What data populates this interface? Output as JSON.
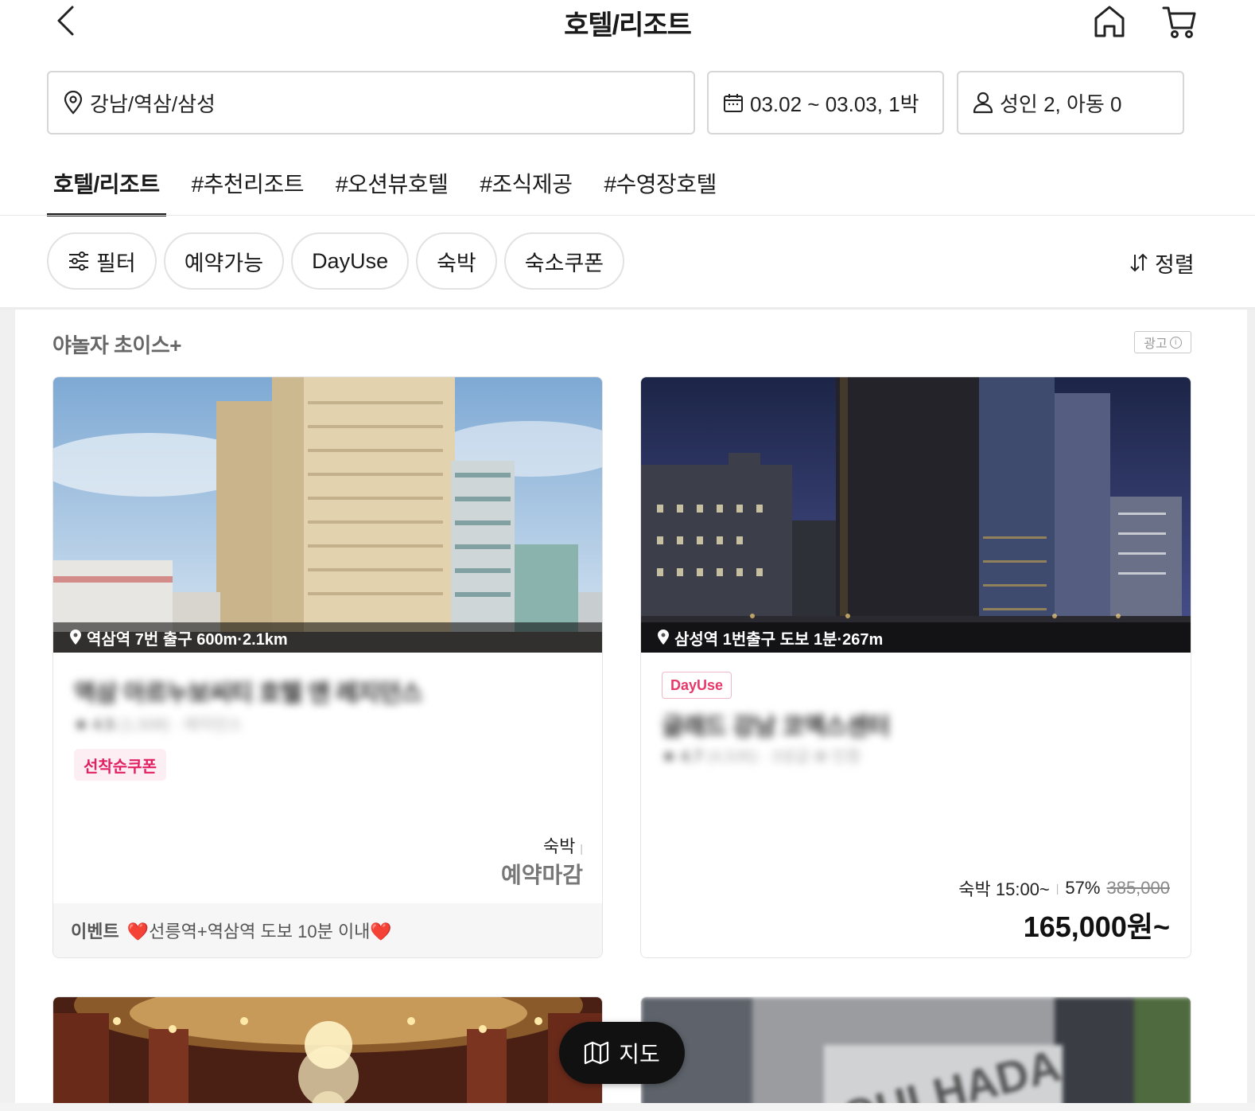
{
  "header": {
    "title": "호텔/리조트"
  },
  "search": {
    "location": "강남/역삼/삼성",
    "dates": "03.02 ~ 03.03, 1박",
    "guests": "성인 2, 아동 0"
  },
  "tabs": [
    {
      "label": "호텔/리조트",
      "active": true
    },
    {
      "label": "#추천리조트"
    },
    {
      "label": "#오션뷰호텔"
    },
    {
      "label": "#조식제공"
    },
    {
      "label": "#수영장호텔"
    }
  ],
  "filters": {
    "filter_label": "필터",
    "chips": [
      "예약가능",
      "DayUse",
      "숙박",
      "숙소쿠폰"
    ],
    "sort_label": "정렬"
  },
  "section": {
    "title": "야놀자 초이스+",
    "ad_label": "광고"
  },
  "cards": [
    {
      "location": "역삼역 7번 출구 600m·2.1km",
      "name": "역삼 아르누보씨티 호텔 앤 레지던스",
      "rating": "★ 4.5",
      "reviews": "(1,508)",
      "category": "· 레지던스",
      "coupon": "선착순쿠폰",
      "price_type": "숙박",
      "status": "예약마감",
      "event_label": "이벤트",
      "event_text": "❤️선릉역+역삼역 도보 10분 이내❤️"
    },
    {
      "location": "삼성역 1번출구 도보 1분·267m",
      "badge": "DayUse",
      "name": "글래드 강남 코엑스센터",
      "rating": "★ 4.7",
      "reviews": "(4,535)",
      "category": "· 3성급",
      "cert": "✿ 인증",
      "price_type": "숙박 15:00~",
      "discount": "57%",
      "original_price": "385,000",
      "price": "165,000원~"
    }
  ],
  "map_button": {
    "label": "지도"
  },
  "colors": {
    "accent_pink": "#e21f62",
    "dark": "#111111"
  }
}
